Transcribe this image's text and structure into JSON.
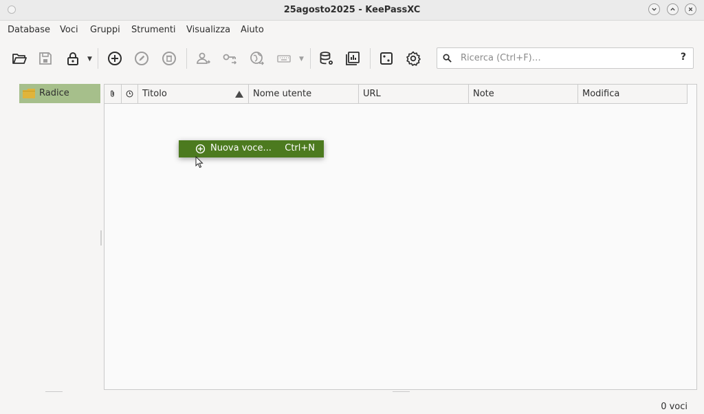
{
  "window": {
    "title": "25agosto2025 - KeePassXC"
  },
  "menu": [
    "Database",
    "Voci",
    "Gruppi",
    "Strumenti",
    "Visualizza",
    "Aiuto"
  ],
  "toolbar": {
    "icons": [
      "open-database-icon",
      "save-database-icon",
      "lock-database-icon",
      "add-entry-icon",
      "edit-entry-icon",
      "delete-entry-icon",
      "copy-username-icon",
      "copy-password-icon",
      "open-url-icon",
      "autotype-icon",
      "database-settings-icon",
      "database-reports-icon",
      "password-generator-icon",
      "settings-icon"
    ]
  },
  "search": {
    "placeholder": "Ricerca (Ctrl+F)…",
    "help": "?"
  },
  "groups": {
    "root": "Radice"
  },
  "columns": {
    "title": "Titolo",
    "username": "Nome utente",
    "url": "URL",
    "notes": "Note",
    "modified": "Modifica"
  },
  "context_menu": {
    "label": "Nuova voce...",
    "shortcut": "Ctrl+N"
  },
  "status": {
    "count": "0 voci"
  },
  "colors": {
    "selection": "#a6bf8b",
    "menu_highlight": "#4c7a1f",
    "folder": "#e0b43a"
  }
}
